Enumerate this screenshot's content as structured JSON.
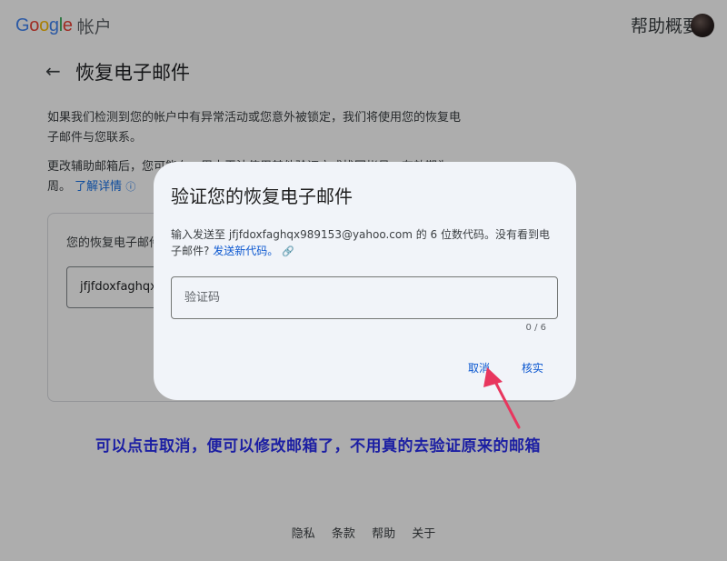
{
  "header": {
    "logo_text": "Google",
    "product": "帐户",
    "help_text": "帮助概要",
    "logo_colors": [
      "#4285F4",
      "#EA4335",
      "#FBBC05",
      "#4285F4",
      "#34A853",
      "#EA4335"
    ]
  },
  "page": {
    "back_icon": "arrow-back-icon",
    "title": "恢复电子邮件",
    "para1": "如果我们检测到您的帐户中有异常活动或您意外被锁定，我们将使用您的恢复电子邮件与您联系。",
    "para2": "更改辅助邮箱后，您可能在一周内无法使用其他验证方式找回帐号。有效期为一周。",
    "learn_more": "了解详情",
    "card_label": "您的恢复电子邮件",
    "card_value": "jfjfdoxfaghqx989153@yahoo.com"
  },
  "dialog": {
    "title": "验证您的恢复电子邮件",
    "desc": "输入发送至 jfjfdoxfaghqx989153@yahoo.com 的 6 位数代码。没有看到电子邮件?",
    "resend": "发送新代码。",
    "code_placeholder": "验证码",
    "code_value": "",
    "counter": "0 / 6",
    "cancel": "取消",
    "verify": "核实"
  },
  "annotation": {
    "text": "可以点击取消，便可以修改邮箱了，不用真的去验证原来的邮箱",
    "arrow_color": "#e8365e"
  },
  "footer": {
    "items": [
      "隐私",
      "条款",
      "帮助",
      "关于"
    ]
  }
}
